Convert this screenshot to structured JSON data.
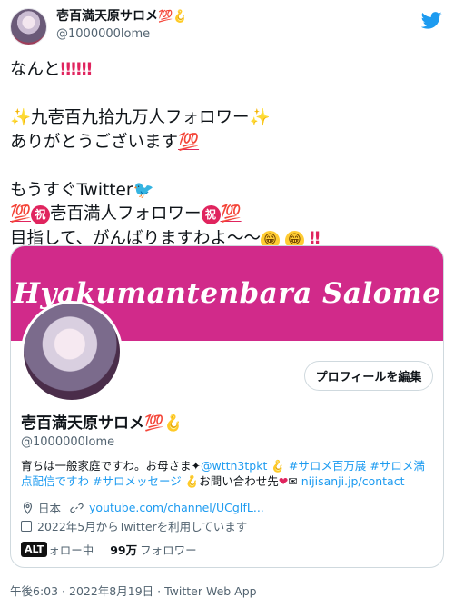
{
  "author": {
    "display_name": "壱百満天原サロメ",
    "name_emoji": "💯🪝",
    "handle": "@1000000lome"
  },
  "tweet": {
    "line1_text": "なんと",
    "line1_marks": "‼‼‼",
    "line2_spark": "✨",
    "line2_text": "九壱百九拾九万人フォロワー",
    "line3_text": "ありがとうございます",
    "hundred": "💯",
    "line4_text": "もうすぐTwitter",
    "bird": "🐦",
    "iwai": "祝",
    "line5_text": "壱百満人フォロワー",
    "line6_text": "目指して、がんばりますわよ～～",
    "smile": "😁",
    "line6_end": "‼"
  },
  "card": {
    "banner_title": "Hyakumantenbara Salome",
    "follow_button_label": "プロフィールを編集",
    "name": "壱百満天原サロメ",
    "name_emoji": "💯🪝",
    "handle": "@1000000lome",
    "bio_part1": "育ちは一般家庭ですわ。お母さま✦",
    "bio_link_mother": "@wttn3tpkt",
    "bio_hook1": " 🪝 ",
    "bio_tag1": "#サロメ百万展",
    "bio_tag2": "#サロメ満点配信ですわ",
    "bio_tag3": "#サロメッセージ",
    "bio_part2": " 🪝お問い合わせ先",
    "bio_heart": "❤",
    "bio_mail": "✉",
    "bio_contact": "nijisanji.jp/contact",
    "location": "日本",
    "location_icon": "location-pin-icon",
    "website": "youtube.com/channel/UCgIfL...",
    "joined": "2022年5月からTwitterを利用しています",
    "alt_badge": "ALT",
    "following_label": "ォロー中",
    "followers_count": "99万",
    "followers_label": "フォロワー"
  },
  "footer": {
    "timestamp": "午後6:03 · 2022年8月19日 · Twitter Web App"
  },
  "colors": {
    "brand_blue": "#1d9bf0",
    "banner_magenta": "#d12a8a",
    "emphasis_red": "#e0245e"
  }
}
